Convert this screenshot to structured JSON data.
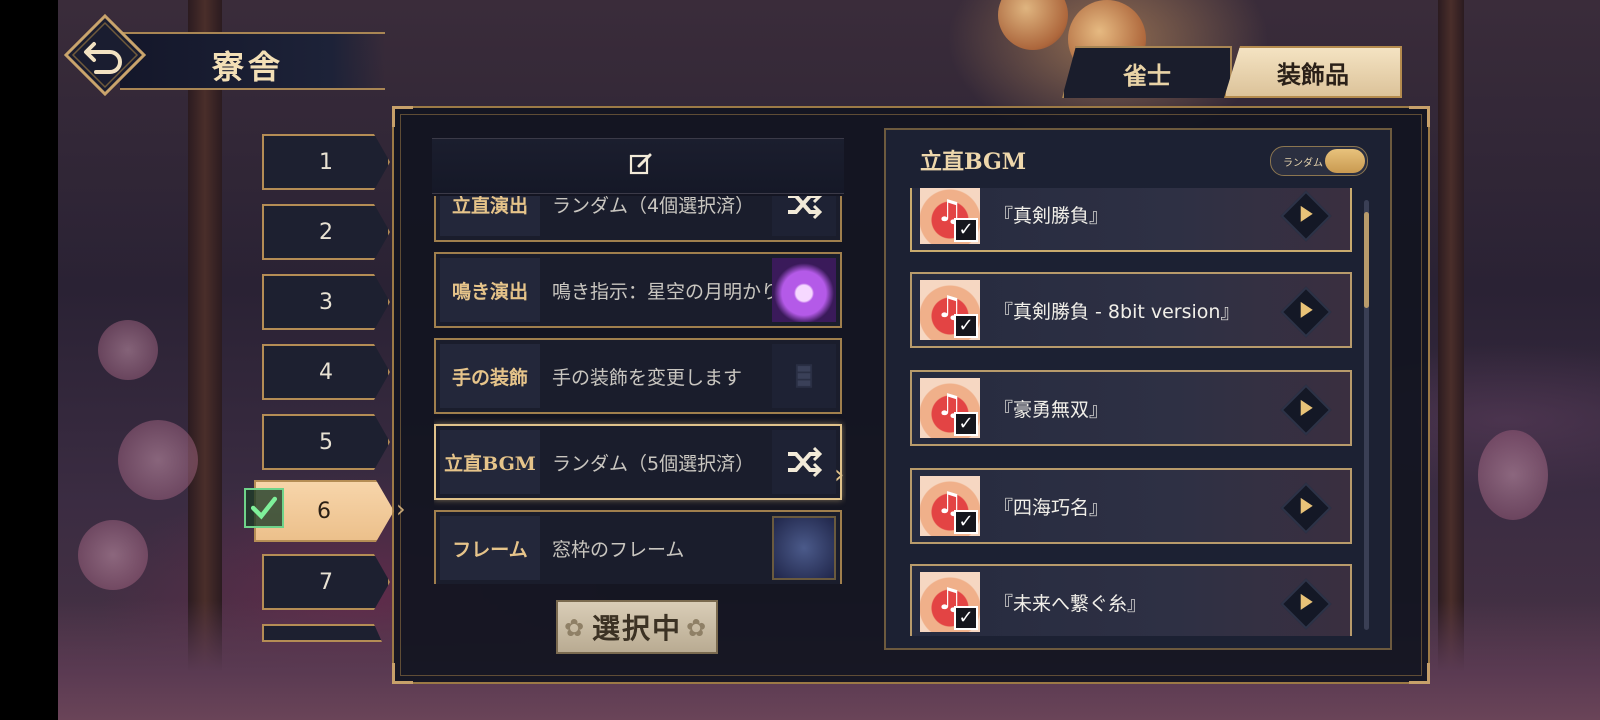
{
  "header": {
    "title": "寮舎",
    "back_icon": "back-arrow-icon"
  },
  "tabs": [
    {
      "label": "雀士",
      "active": false
    },
    {
      "label": "装飾品",
      "active": true
    }
  ],
  "slots": [
    {
      "label": "1"
    },
    {
      "label": "2"
    },
    {
      "label": "3"
    },
    {
      "label": "4"
    },
    {
      "label": "5"
    },
    {
      "label": "6",
      "active": true
    },
    {
      "label": "7"
    }
  ],
  "rows": [
    {
      "label": "立直演出",
      "value": "ランダム（4個選択済）",
      "icon": "shuffle-icon"
    },
    {
      "label": "鳴き演出",
      "value": "鳴き指示：星空の月明かり",
      "icon": "starry-moon-thumbnail"
    },
    {
      "label": "手の装飾",
      "value": "手の装飾を変更します",
      "icon": "hand-icon"
    },
    {
      "label": "立直BGM",
      "value": "ランダム（5個選択済）",
      "icon": "shuffle-icon",
      "active": true
    },
    {
      "label": "フレーム",
      "value": "窓枠のフレーム",
      "icon": "frame-thumbnail"
    }
  ],
  "select_button": {
    "label": "選択中"
  },
  "bgm_panel": {
    "title": "立直BGM",
    "random_label": "ランダム",
    "random_on": true,
    "items": [
      {
        "name": "『真剣勝負』",
        "checked": true
      },
      {
        "name": "『真剣勝負 - 8bit version』",
        "checked": true
      },
      {
        "name": "『豪勇無双』",
        "checked": true
      },
      {
        "name": "『四海巧名』",
        "checked": true
      },
      {
        "name": "『未来へ繋ぐ糸』",
        "checked": true
      }
    ]
  },
  "colors": {
    "gold": "#b58d55",
    "active_slot": "#f2cc9b",
    "panel_bg": "#1a1d2c"
  }
}
